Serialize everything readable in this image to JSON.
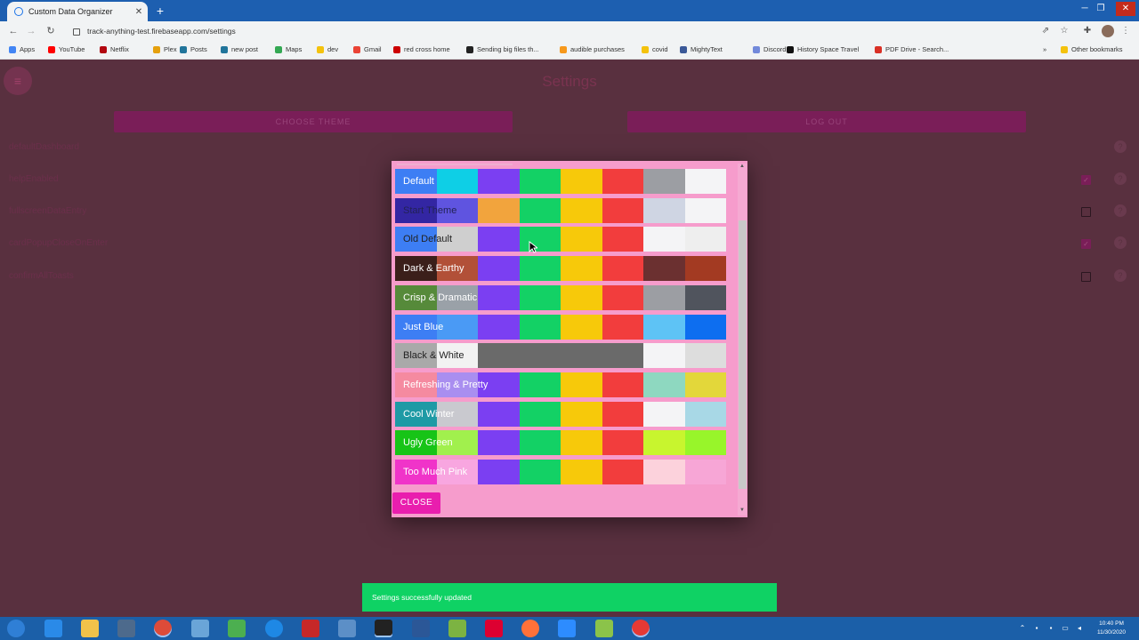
{
  "browser": {
    "tab_title": "Custom Data Organizer",
    "tab_close": "✕",
    "new_tab": "+",
    "url": "track-anything-test.firebaseapp.com/settings",
    "bookmarks": [
      {
        "label": "Apps",
        "color": "#4285f4"
      },
      {
        "label": "YouTube",
        "color": "#ff0000"
      },
      {
        "label": "Netflix",
        "color": "#b20710"
      },
      {
        "label": "Plex",
        "color": "#e5a00d"
      },
      {
        "label": "Posts",
        "color": "#21759b"
      },
      {
        "label": "new post",
        "color": "#21759b"
      },
      {
        "label": "Maps",
        "color": "#34a853"
      },
      {
        "label": "dev",
        "color": "#f4c20d"
      },
      {
        "label": "Gmail",
        "color": "#ea4335"
      },
      {
        "label": "red cross home",
        "color": "#cc0000"
      },
      {
        "label": "Sending big files th...",
        "color": "#222222"
      },
      {
        "label": "audible purchases",
        "color": "#f7991c"
      },
      {
        "label": "covid",
        "color": "#f4c20d"
      },
      {
        "label": "MightyText",
        "color": "#3b5998"
      },
      {
        "label": "Discord",
        "color": "#7289da"
      },
      {
        "label": "History Space Travel",
        "color": "#111111"
      },
      {
        "label": "PDF Drive - Search...",
        "color": "#d93025"
      }
    ],
    "other_bookmarks": "Other bookmarks"
  },
  "app": {
    "title": "Settings",
    "choose_theme": "CHOOSE THEME",
    "log_out": "LOG OUT",
    "settings": [
      {
        "label": "defaultDashboard",
        "checkbox": null
      },
      {
        "label": "helpEnabled",
        "checkbox": true
      },
      {
        "label": "fullscreenDataEntry",
        "checkbox": false
      },
      {
        "label": "cardPopupCloseOnEnter",
        "checkbox": true
      },
      {
        "label": "confirmAllToasts",
        "checkbox": false
      }
    ],
    "help_glyph": "?",
    "check_glyph": "✓"
  },
  "theme_dialog": {
    "themes": [
      {
        "name": "Default",
        "name_color": "#ffffff",
        "colors": [
          "#3d7ef4",
          "#0ecfe6",
          "#7b3ff2",
          "#13d165",
          "#f7c90a",
          "#f23d3d",
          "#9c9ea3",
          "#f4f4f6"
        ]
      },
      {
        "name": "Start Theme",
        "name_color": "#222255",
        "colors": [
          "#3326a3",
          "#5f54e0",
          "#f2a43d",
          "#13d165",
          "#f7c90a",
          "#f23d3d",
          "#cfd5e3",
          "#f4f4f6"
        ]
      },
      {
        "name": "Old Default",
        "name_color": "#222222",
        "colors": [
          "#3d7ef4",
          "#cfcfcf",
          "#7b3ff2",
          "#13d165",
          "#f7c90a",
          "#f23d3d",
          "#f4f4f6",
          "#eeeeee"
        ]
      },
      {
        "name": "Dark & Earthy",
        "name_color": "#ffffff",
        "colors": [
          "#3b1f1a",
          "#b25038",
          "#7b3ff2",
          "#13d165",
          "#f7c90a",
          "#f23d3d",
          "#6b3030",
          "#a33a22"
        ]
      },
      {
        "name": "Crisp & Dramatic",
        "name_color": "#ffffff",
        "colors": [
          "#568a3a",
          "#9aa1a8",
          "#7b3ff2",
          "#13d165",
          "#f7c90a",
          "#f23d3d",
          "#9c9ea3",
          "#50545d"
        ]
      },
      {
        "name": "Just Blue",
        "name_color": "#ffffff",
        "colors": [
          "#3d7ef4",
          "#4a9af5",
          "#7b3ff2",
          "#13d165",
          "#f7c90a",
          "#f23d3d",
          "#5ec3f5",
          "#0d6ef0"
        ]
      },
      {
        "name": "Black & White",
        "name_color": "#222222",
        "colors": [
          "#a9a9a9",
          "#f2f2f2",
          "#6a6a6a",
          "#6a6a6a",
          "#6a6a6a",
          "#6a6a6a",
          "#f4f4f6",
          "#dddddd"
        ]
      },
      {
        "name": "Refreshing & Pretty",
        "name_color": "#ffffff",
        "colors": [
          "#f58aa0",
          "#a98ef0",
          "#7b3ff2",
          "#13d165",
          "#f7c90a",
          "#f23d3d",
          "#8ed8c0",
          "#e3d73a"
        ]
      },
      {
        "name": "Cool Winter",
        "name_color": "#ffffff",
        "colors": [
          "#1e9aa5",
          "#c9c9cf",
          "#7b3ff2",
          "#13d165",
          "#f7c90a",
          "#f23d3d",
          "#f4f4f6",
          "#a8d8e6"
        ]
      },
      {
        "name": "Ugly Green",
        "name_color": "#ffffff",
        "colors": [
          "#17c417",
          "#a1f04d",
          "#7b3ff2",
          "#13d165",
          "#f7c90a",
          "#f23d3d",
          "#c8f52e",
          "#98f52a"
        ]
      },
      {
        "name": "Too Much Pink",
        "name_color": "#ffffff",
        "colors": [
          "#f034c9",
          "#f8a6e0",
          "#7b3ff2",
          "#13d165",
          "#f7c90a",
          "#f23d3d",
          "#fcd2dc",
          "#f7a6d6"
        ]
      }
    ],
    "close_label": "CLOSE"
  },
  "toast": {
    "message": "Settings successfully updated"
  },
  "taskbar": {
    "time": "10:40 PM",
    "date": "11/30/2020"
  }
}
